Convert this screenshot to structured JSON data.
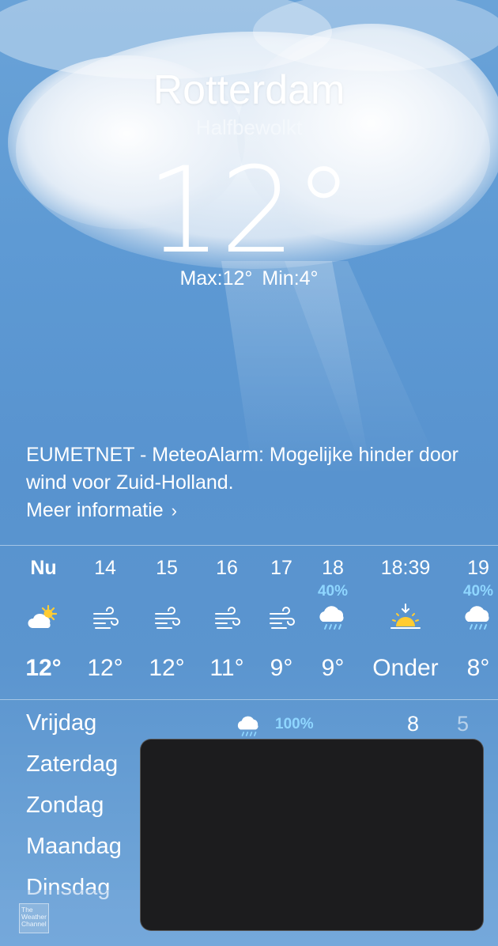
{
  "location": {
    "city": "Rotterdam",
    "condition": "Halfbewolkt",
    "temperature": "12°",
    "max": "Max:12°",
    "min": "Min:4°"
  },
  "alert": {
    "text": "EUMETNET - MeteoAlarm: Mogelijke hinder door wind voor Zuid-Holland.",
    "more_label": "Meer informatie",
    "chevron": "›"
  },
  "hourly": [
    {
      "label": "Nu",
      "pct": "",
      "icon": "partly-sunny-icon",
      "temp": "12°"
    },
    {
      "label": "14",
      "pct": "",
      "icon": "wind-icon",
      "temp": "12°"
    },
    {
      "label": "15",
      "pct": "",
      "icon": "wind-icon",
      "temp": "12°"
    },
    {
      "label": "16",
      "pct": "",
      "icon": "wind-icon",
      "temp": "11°"
    },
    {
      "label": "17",
      "pct": "",
      "icon": "wind-icon",
      "temp": "9°"
    },
    {
      "label": "18",
      "pct": "40%",
      "icon": "rain-cloud-icon",
      "temp": "9°"
    },
    {
      "label": "18:39",
      "pct": "",
      "icon": "sunset-icon",
      "temp": "Onder"
    },
    {
      "label": "19",
      "pct": "40%",
      "icon": "rain-cloud-icon",
      "temp": "8°"
    }
  ],
  "daily": [
    {
      "day": "Vrijdag",
      "icon": "rain-cloud-icon",
      "pct": "100%",
      "max": "8",
      "min": "5"
    },
    {
      "day": "Zaterdag"
    },
    {
      "day": "Zondag"
    },
    {
      "day": "Maandag"
    },
    {
      "day": "Dinsdag"
    }
  ],
  "footer": {
    "logo_text_1": "The",
    "logo_text_2": "Weather",
    "logo_text_3": "Channel"
  },
  "colors": {
    "sky": "#5e9ad4",
    "precip": "#8fd6ff",
    "sun": "#ffcc33",
    "overlay": "#1c1c1e"
  }
}
